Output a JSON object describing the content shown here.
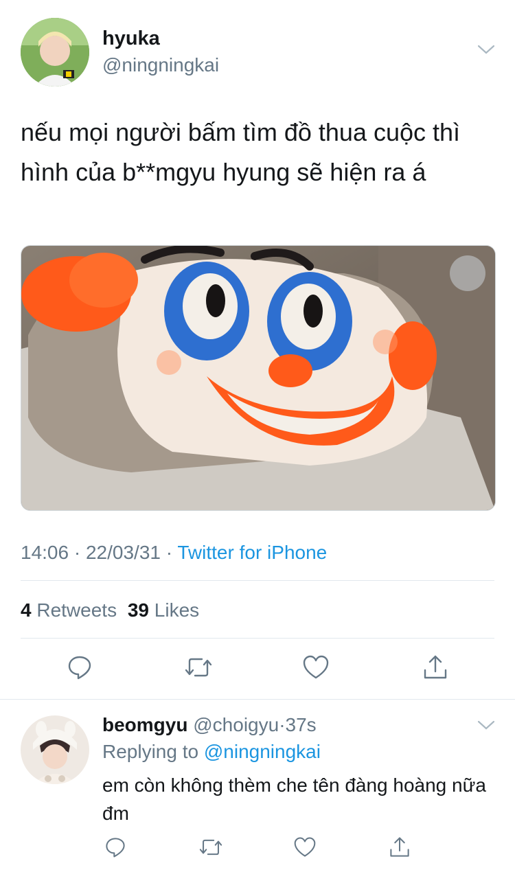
{
  "tweet": {
    "author_name": "hyuka",
    "author_handle": "@ningningkai",
    "text": "nếu mọi người bấm tìm đồ thua cuộc thì hình của b**mgyu hyung sẽ hiện ra á",
    "time": "14:06",
    "separator": "·",
    "date": "22/03/31",
    "client": "Twitter for iPhone",
    "retweets_count": "4",
    "retweets_label": "Retweets",
    "likes_count": "39",
    "likes_label": "Likes"
  },
  "reply": {
    "author_name": "beomgyu",
    "author_handle": "@choigyu",
    "separator": "·",
    "age": "37s",
    "replying_label": "Replying to",
    "replying_handle": "@ningningkai",
    "text": "em còn không thèm che tên đàng hoàng nữa đm"
  },
  "icons": [
    "reply-icon",
    "retweet-icon",
    "like-icon",
    "share-icon",
    "chevron-down-icon"
  ],
  "colors": {
    "link": "#1b95e0",
    "muted": "#657786",
    "divider": "#e1e8ed"
  }
}
